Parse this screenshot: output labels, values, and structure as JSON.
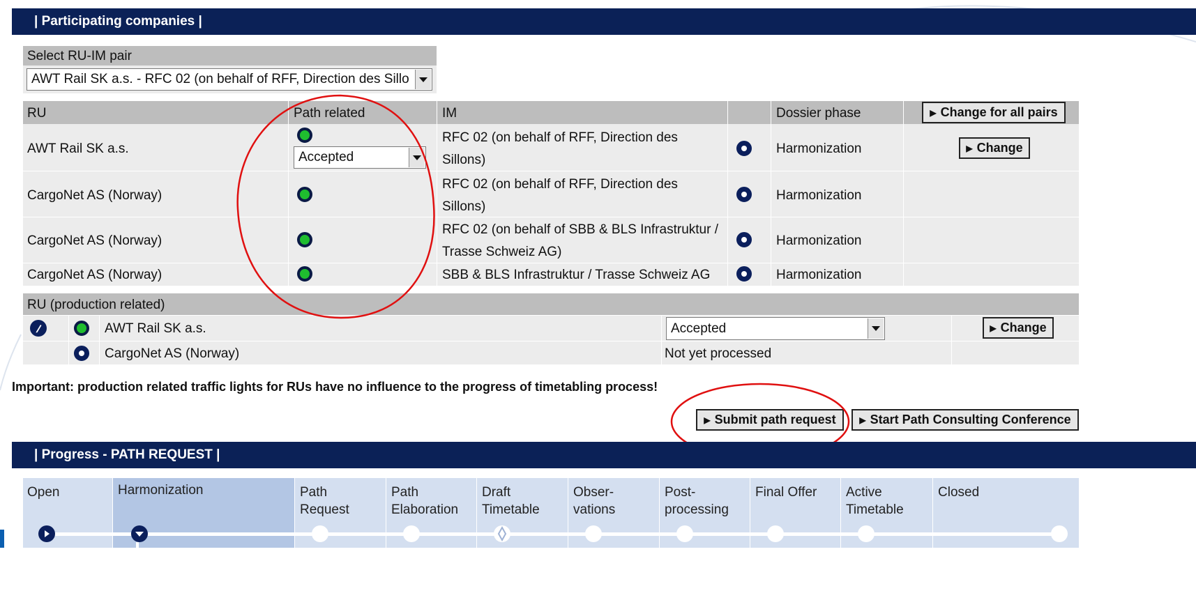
{
  "participating": {
    "title": "| Participating companies |",
    "select_label": "Select RU-IM pair",
    "select_value": "AWT Rail SK a.s. - RFC 02 (on behalf of RFF, Direction des Sillo",
    "headers": {
      "ru": "RU",
      "path_related": "Path related",
      "im": "IM",
      "dossier_phase": "Dossier phase"
    },
    "change_all_label": "Change for all pairs",
    "change_label": "Change",
    "rows": [
      {
        "ru": "AWT Rail SK a.s.",
        "status_select": "Accepted",
        "im_line1": "RFC 02 (on behalf of RFF, Direction des",
        "im_line2": "Sillons)",
        "phase": "Harmonization"
      },
      {
        "ru": "CargoNet AS (Norway)",
        "im_line1": "RFC 02 (on behalf of RFF, Direction des",
        "im_line2": "Sillons)",
        "phase": "Harmonization"
      },
      {
        "ru": "CargoNet AS (Norway)",
        "im_line1": "RFC 02 (on behalf of SBB & BLS Infrastruktur /",
        "im_line2": "Trasse Schweiz AG)",
        "phase": "Harmonization"
      },
      {
        "ru": "CargoNet AS (Norway)",
        "im": "SBB & BLS Infrastruktur / Trasse Schweiz AG",
        "phase": "Harmonization"
      }
    ],
    "production": {
      "header": "RU (production related)",
      "rows": [
        {
          "ru": "AWT Rail SK a.s.",
          "status_select": "Accepted",
          "change_label": "Change"
        },
        {
          "ru": "CargoNet AS (Norway)",
          "status": "Not yet processed"
        }
      ]
    },
    "important_note": "Important: production related traffic lights for RUs have no influence to the progress of timetabling process!",
    "submit_label": "Submit path request",
    "conference_label": "Start Path Consulting Conference"
  },
  "progress": {
    "title": "| Progress - PATH REQUEST |",
    "steps": [
      {
        "l1": "Open",
        "l2": ""
      },
      {
        "l1": "Harmonization",
        "l2": ""
      },
      {
        "l1": "Path",
        "l2": "Request"
      },
      {
        "l1": "Path",
        "l2": "Elaboration"
      },
      {
        "l1": "Draft",
        "l2": "Timetable"
      },
      {
        "l1": "Obser-",
        "l2": "vations"
      },
      {
        "l1": "Post-",
        "l2": "processing"
      },
      {
        "l1": "Final Offer",
        "l2": ""
      },
      {
        "l1": "Active",
        "l2": "Timetable"
      },
      {
        "l1": "Closed",
        "l2": ""
      }
    ]
  },
  "colors": {
    "header_navy": "#0b2157",
    "light_green": "#1fbd2f",
    "light_blue": "#0b1f5c",
    "annotation_red": "#e01010"
  },
  "icons": [
    "traffic-light-green-icon",
    "traffic-light-blue-icon",
    "edit-pencil-icon",
    "dropdown-arrow-icon",
    "play-icon",
    "chevron-down-icon"
  ]
}
